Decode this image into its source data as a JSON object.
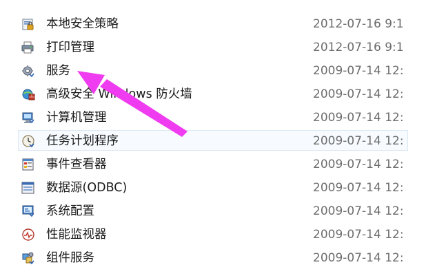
{
  "items": [
    {
      "name": "本地安全策略",
      "date": "2012-07-16 9:1",
      "icon": "local-security-policy-icon"
    },
    {
      "name": "打印管理",
      "date": "2012-07-16 9:1",
      "icon": "print-management-icon"
    },
    {
      "name": "服务",
      "date": "2009-07-14 12:",
      "icon": "services-gear-icon"
    },
    {
      "name": "高级安全 Windows 防火墙",
      "date": "2009-07-14 12:",
      "icon": "firewall-icon"
    },
    {
      "name": "计算机管理",
      "date": "2009-07-14 12:",
      "icon": "computer-management-icon"
    },
    {
      "name": "任务计划程序",
      "date": "2009-07-14 12:",
      "icon": "task-scheduler-clock-icon"
    },
    {
      "name": "事件查看器",
      "date": "2009-07-14 12:",
      "icon": "event-viewer-icon"
    },
    {
      "name": "数据源(ODBC)",
      "date": "2009-07-14 12:",
      "icon": "odbc-data-source-icon"
    },
    {
      "name": "系统配置",
      "date": "2009-07-14 12:",
      "icon": "system-configuration-icon"
    },
    {
      "name": "性能监视器",
      "date": "2009-07-14 12:",
      "icon": "performance-monitor-icon"
    },
    {
      "name": "组件服务",
      "date": "2009-07-14 12:",
      "icon": "component-services-icon"
    }
  ],
  "selected_item": "任务计划程序",
  "annotation": {
    "arrow_color": "#f03cf0",
    "points_to": "服务"
  }
}
